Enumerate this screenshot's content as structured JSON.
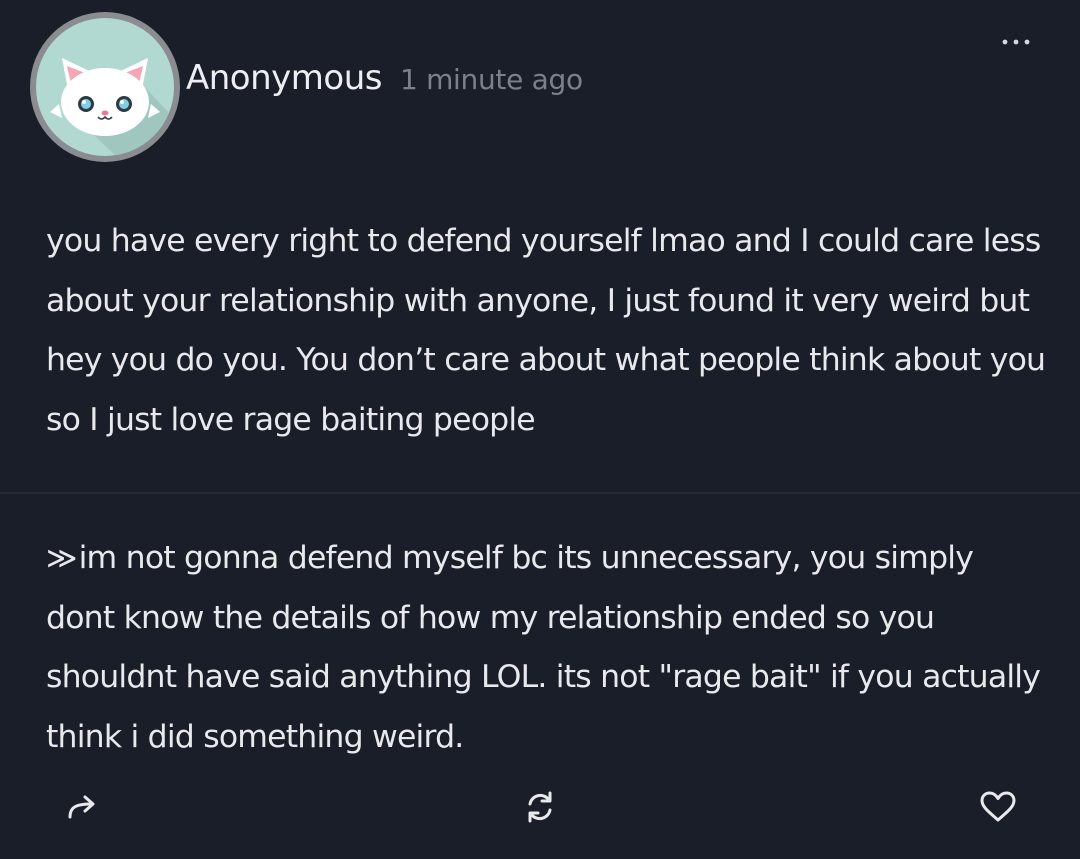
{
  "post": {
    "author": "Anonymous",
    "timestamp": "1 minute ago",
    "avatar_icon": "white-cat-avatar",
    "more_icon": "more-dots-icon"
  },
  "question": {
    "text": "you have every right to defend yourself lmao and I could care less about your relationship with anyone, I just found it very weird but hey you do you. You don’t care about what people think about you so I just love rage baiting people"
  },
  "answer": {
    "marker": "≫",
    "text": "im not gonna defend myself bc its unnecessary, you simply dont know the details of how my relationship ended so you shouldnt have said anything LOL. its not \"rage bait\" if you actually think i did something weird."
  },
  "actions": {
    "share_icon": "share-arrow-icon",
    "reask_icon": "refresh-icon",
    "like_icon": "heart-icon"
  },
  "colors": {
    "background": "#1a1e28",
    "text": "#e8e9ec",
    "muted": "#7b808b",
    "avatar_bg": "#b2d9d1",
    "avatar_ring": "#8a8c92"
  }
}
